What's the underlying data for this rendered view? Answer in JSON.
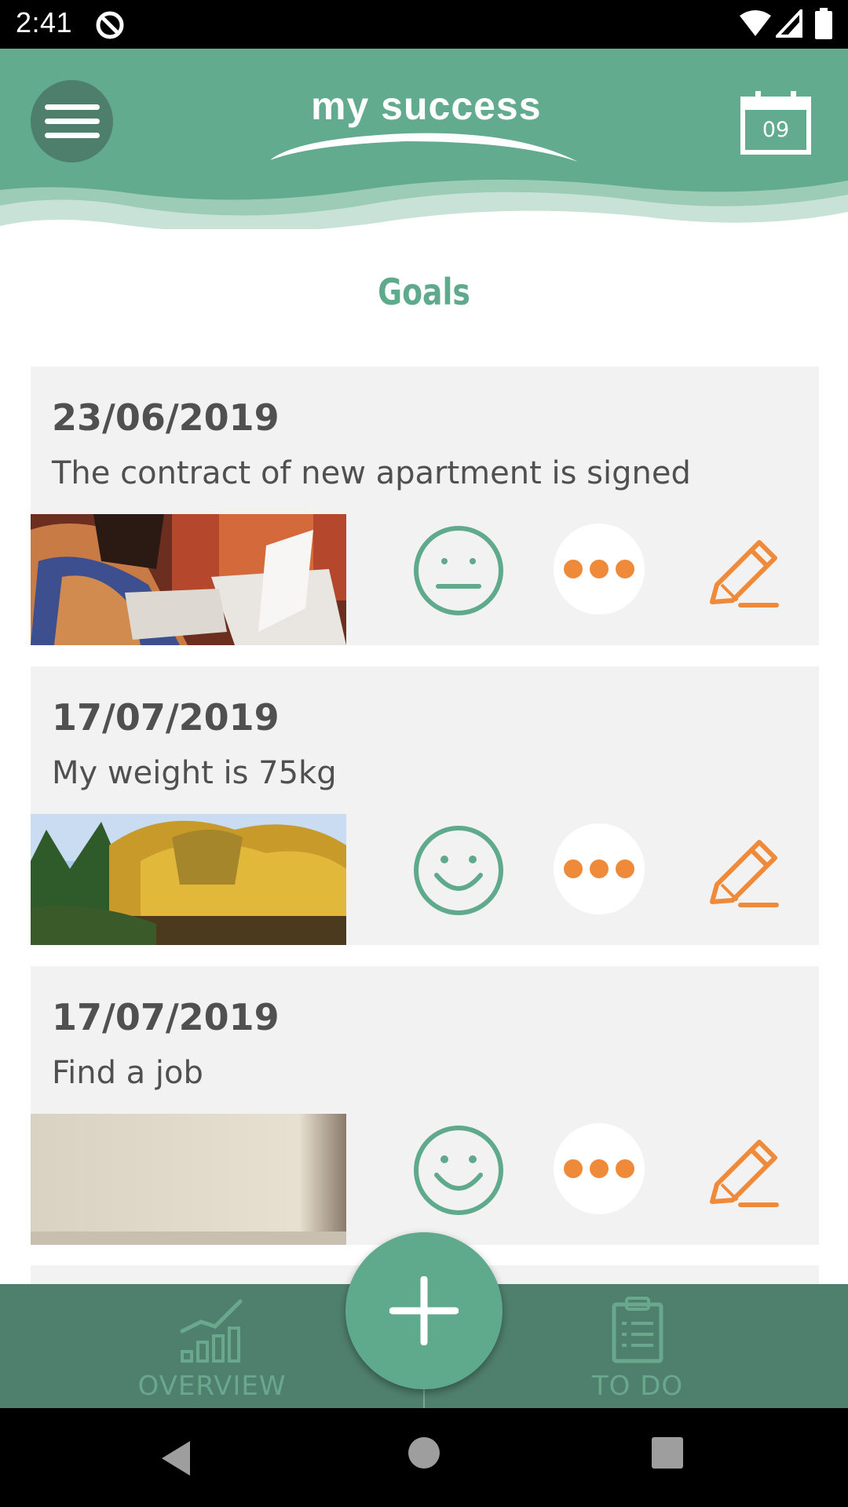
{
  "status_bar": {
    "time": "2:41",
    "icons": [
      "sync-icon",
      "wifi-icon",
      "signal-icon",
      "battery-icon"
    ]
  },
  "header": {
    "logo_text": "my success",
    "calendar_day": "09",
    "icons": [
      "menu-icon",
      "calendar-icon"
    ]
  },
  "page": {
    "title": "Goals"
  },
  "goals": [
    {
      "date": "23/06/2019",
      "text": "The contract of new apartment is signed",
      "mood": "neutral",
      "photo": "people-with-papers-photo"
    },
    {
      "date": "17/07/2019",
      "text": "My weight is 75kg",
      "mood": "happy",
      "photo": "autumn-trees-photo"
    },
    {
      "date": "17/07/2019",
      "text": "Find a job",
      "mood": "happy",
      "photo": "beige-wall-photo"
    }
  ],
  "bottom_nav": {
    "overview_label": "OVERVIEW",
    "todo_label": "TO DO",
    "icons": [
      "chart-icon",
      "plus-icon",
      "clipboard-icon"
    ]
  },
  "colors": {
    "primary_green": "#63ab8e",
    "dark_green": "#4f7f6d",
    "accent_orange": "#ef8a3a",
    "card_grey": "#f2f2f2",
    "text_grey": "#505050"
  }
}
